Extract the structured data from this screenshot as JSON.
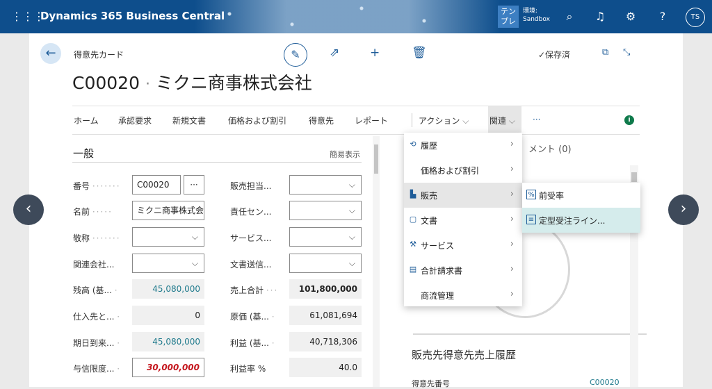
{
  "topbar": {
    "product_name": "Dynamics 365 Business Central",
    "env_badge": "テンプレ",
    "env_label": "環境:",
    "env_name": "Sandbox",
    "avatar_initials": "TS"
  },
  "page": {
    "type_label": "得意先カード",
    "code": "C00020",
    "separator": "·",
    "name": "ミクニ商事株式会社",
    "saved_status": "✓保存済"
  },
  "menu": {
    "home": "ホーム",
    "approval": "承認要求",
    "new_document": "新規文書",
    "prices_discounts": "価格および割引",
    "customer": "得意先",
    "report": "レポート",
    "actions": "アクション",
    "related": "関連",
    "more": "···"
  },
  "general": {
    "title": "一般",
    "show_less": "簡易表示",
    "fields": {
      "number_label": "番号",
      "number_value": "C00020",
      "name_label": "名前",
      "name_value": "ミクニ商事株式会",
      "honorific_label": "敬称",
      "related_company_label": "関連会社...",
      "balance_label": "残高 (基...",
      "balance_value": "45,080,000",
      "vendor_label": "仕入先と...",
      "vendor_value": "0",
      "due_label": "期日到来...",
      "due_value": "45,080,000",
      "credit_limit_label": "与信限度...",
      "credit_limit_value": "30,000,000",
      "salesperson_label": "販売担当...",
      "responsibility_label": "責任セン...",
      "service_label": "サービス...",
      "doc_sending_label": "文書送信...",
      "sales_total_label": "売上合計",
      "sales_total_value": "101,800,000",
      "cost_label": "原価 (基...",
      "cost_value": "61,081,694",
      "profit_label": "利益 (基...",
      "profit_value": "40,718,306",
      "profit_pct_label": "利益率 %",
      "profit_pct_value": "40.0"
    }
  },
  "factbox": {
    "attachments": "メント (0)",
    "history_title": "販売先得意先売上履歴",
    "history_field": "得意先番号",
    "history_value": "C00020"
  },
  "dropdown": {
    "history": "履歴",
    "prices_discounts": "価格および割引",
    "sales": "販売",
    "documents": "文書",
    "service": "サービス",
    "combined_invoice": "合計請求書",
    "trade_management": "商流管理"
  },
  "submenu": {
    "prepayment": "前受率",
    "recurring_sales_lines": "定型受注ライン..."
  },
  "colors": {
    "topbar": "#0e4e8c",
    "accent": "#1f5d99",
    "highlight": "#d5ecec",
    "credit_limit": "#c4151c"
  }
}
